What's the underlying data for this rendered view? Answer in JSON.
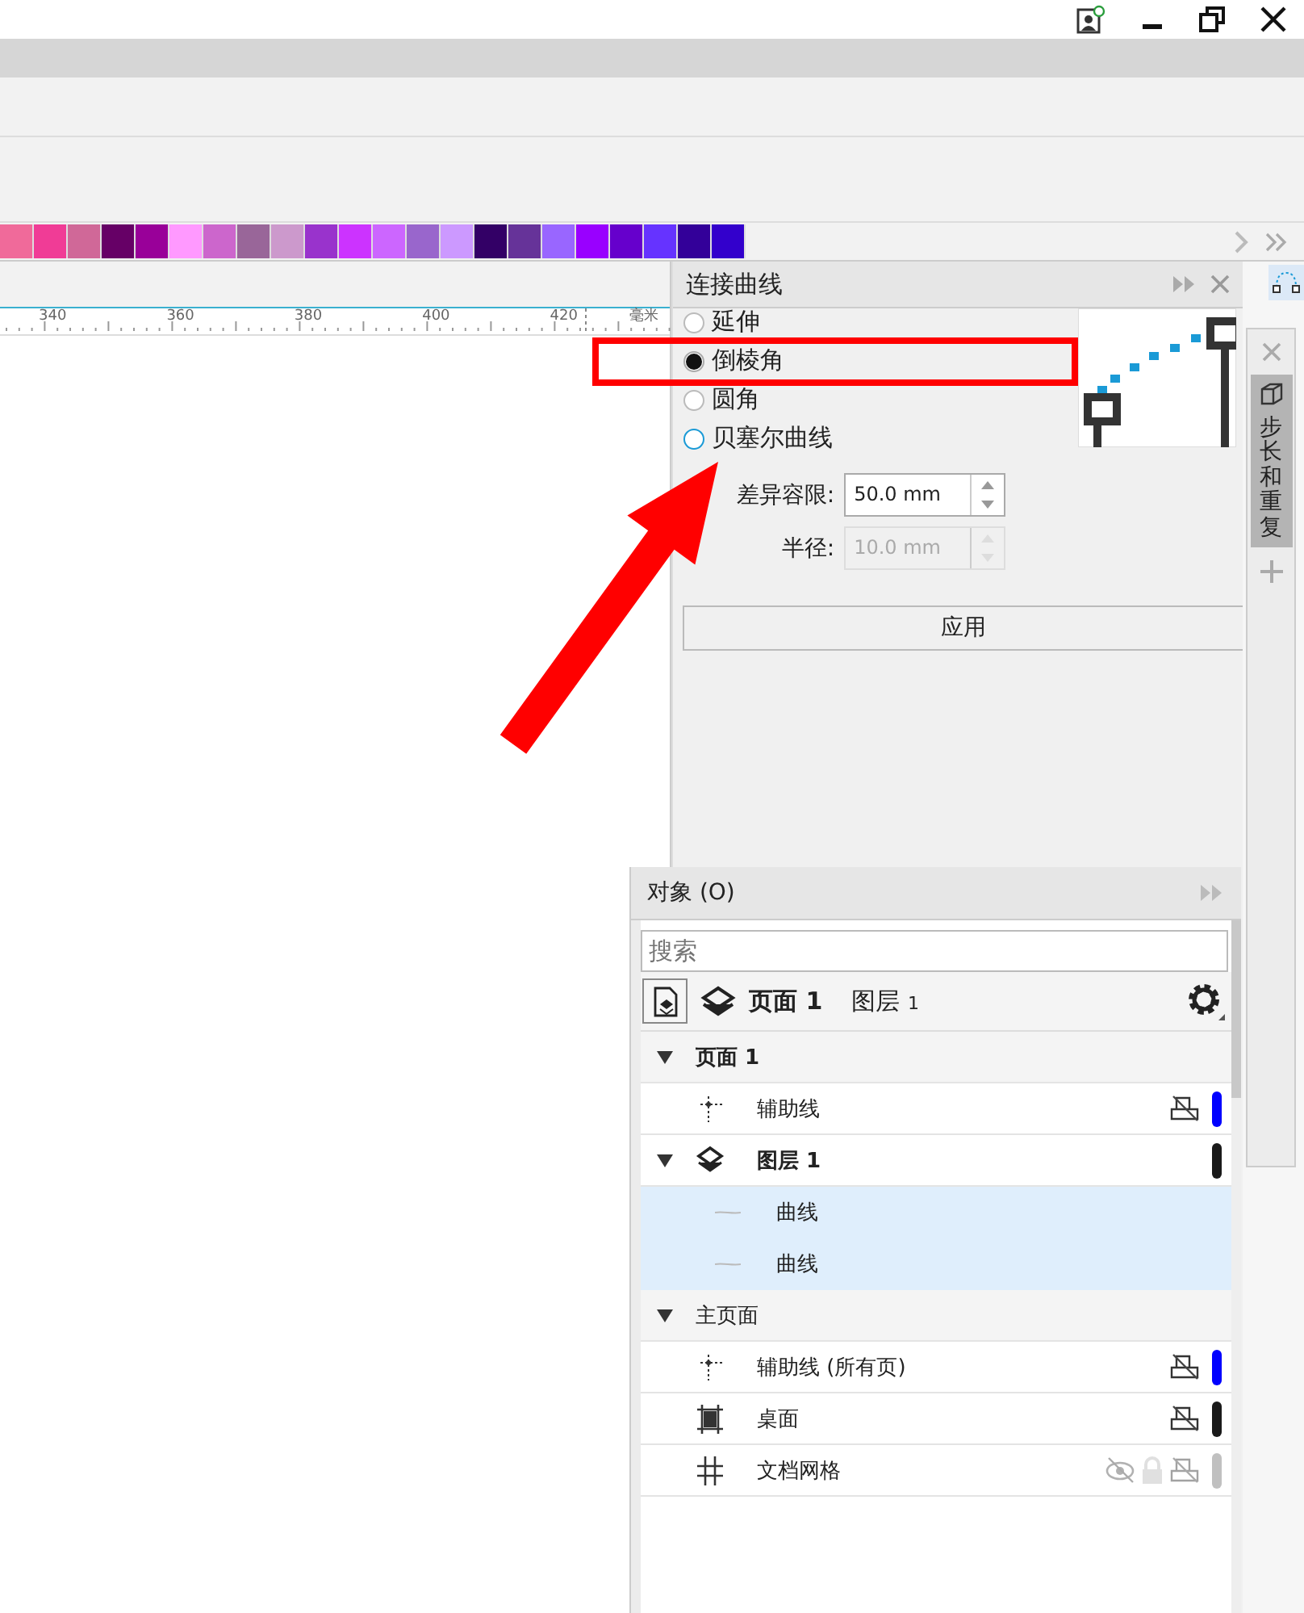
{
  "palette": [
    {
      "color": "#f06a9a"
    },
    {
      "color": "#f03c96"
    },
    {
      "color": "#d06898"
    },
    {
      "color": "#660066"
    },
    {
      "color": "#990099"
    },
    {
      "color": "#ff99ff"
    },
    {
      "color": "#cc66cc"
    },
    {
      "color": "#996699"
    },
    {
      "color": "#cc99cc"
    },
    {
      "color": "#9933cc"
    },
    {
      "color": "#cc33ff"
    },
    {
      "color": "#cc66ff"
    },
    {
      "color": "#9966cc"
    },
    {
      "color": "#cc99ff"
    },
    {
      "color": "#330066"
    },
    {
      "color": "#663399"
    },
    {
      "color": "#9966ff"
    },
    {
      "color": "#9900ff"
    },
    {
      "color": "#6600cc"
    },
    {
      "color": "#6633ff"
    },
    {
      "color": "#330099"
    },
    {
      "color": "#3300cc"
    }
  ],
  "ruler": {
    "labels": [
      "340",
      "360",
      "380",
      "400",
      "420"
    ],
    "unit": "毫米"
  },
  "connect_docker": {
    "title": "连接曲线",
    "options": [
      {
        "label": "延伸",
        "selected": false
      },
      {
        "label": "倒棱角",
        "selected": true
      },
      {
        "label": "圆角",
        "selected": false
      },
      {
        "label": "贝塞尔曲线",
        "selected": false
      }
    ],
    "fields": [
      {
        "label": "差异容限:",
        "value": "50.0 mm",
        "disabled": false
      },
      {
        "label": "半径:",
        "value": "10.0 mm",
        "disabled": true
      }
    ],
    "apply_button": "应用"
  },
  "side_tabs": [
    {
      "label": "步长和重复",
      "selected": true
    }
  ],
  "objects_docker": {
    "title": "对象 (O)",
    "search": {
      "placeholder": "搜索"
    },
    "page_label": "页面 1",
    "layer_label": "图层",
    "layer_number": "1",
    "tree": [
      {
        "kind": "group",
        "label": "页面 1",
        "bold": true,
        "expanded": true,
        "selected": false,
        "children": [
          {
            "kind": "guides",
            "label": "辅助线",
            "bold": false,
            "selected": false,
            "printable": false,
            "color": "#0000ff"
          },
          {
            "kind": "layer",
            "label": "图层 1",
            "bold": true,
            "expanded": true,
            "selected": false,
            "color": "#1a1a1a",
            "children": [
              {
                "kind": "curve",
                "label": "曲线",
                "bold": false,
                "selected": true
              },
              {
                "kind": "curve",
                "label": "曲线",
                "bold": false,
                "selected": true
              }
            ]
          }
        ]
      },
      {
        "kind": "group",
        "label": "主页面",
        "bold": false,
        "expanded": true,
        "selected": false,
        "children": [
          {
            "kind": "guides",
            "label": "辅助线 (所有页)",
            "bold": false,
            "selected": false,
            "printable": false,
            "color": "#0000ff"
          },
          {
            "kind": "desktop",
            "label": "桌面",
            "bold": false,
            "selected": false,
            "printable": false,
            "color": "#1a1a1a"
          },
          {
            "kind": "grid",
            "label": "文档网格",
            "bold": false,
            "selected": false,
            "visible": false,
            "locked": true,
            "printable": false,
            "color": "#c0c0c0"
          }
        ]
      }
    ]
  }
}
